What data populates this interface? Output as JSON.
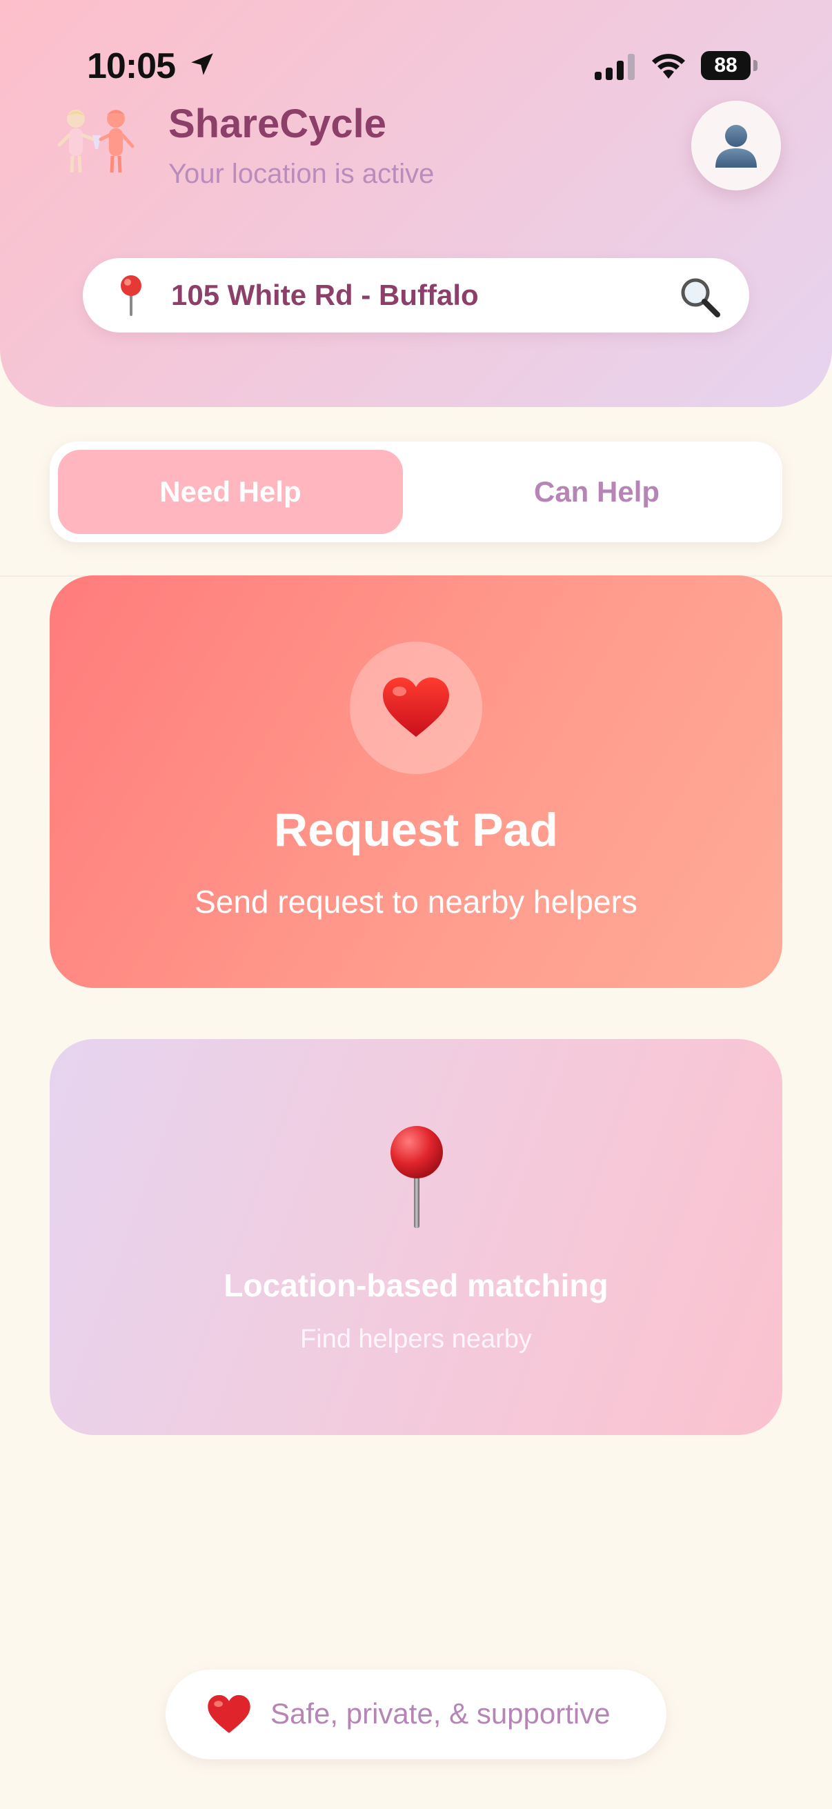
{
  "status_bar": {
    "time": "10:05",
    "battery": "88",
    "icons": [
      "location-arrow-icon",
      "signal-icon",
      "wifi-icon",
      "battery-icon"
    ]
  },
  "header": {
    "app_name": "ShareCycle",
    "subtitle": "Your location is active",
    "avatar_icon": "user-silhouette-icon",
    "brand_icon": "two-people-illustration"
  },
  "search": {
    "address": "105 White Rd - Buffalo",
    "pin_icon": "red-pin-icon",
    "search_icon": "magnifier-icon"
  },
  "tabs": {
    "active": "Need Help",
    "inactive": "Can Help"
  },
  "cards": {
    "request": {
      "title": "Request Pad",
      "subtitle": "Send request to nearby helpers",
      "icon": "heart-icon"
    },
    "location": {
      "title": "Location-based matching",
      "subtitle": "Find helpers nearby",
      "icon": "pushpin-icon"
    }
  },
  "footer": {
    "text": "Safe, private, & supportive",
    "icon": "heart-icon"
  },
  "colors": {
    "brand": "#8c3f68",
    "accent_pink": "#ffb6bf",
    "request_card": "#ff8a80",
    "muted_purple": "#b784b6",
    "background": "#fdf8ee"
  }
}
